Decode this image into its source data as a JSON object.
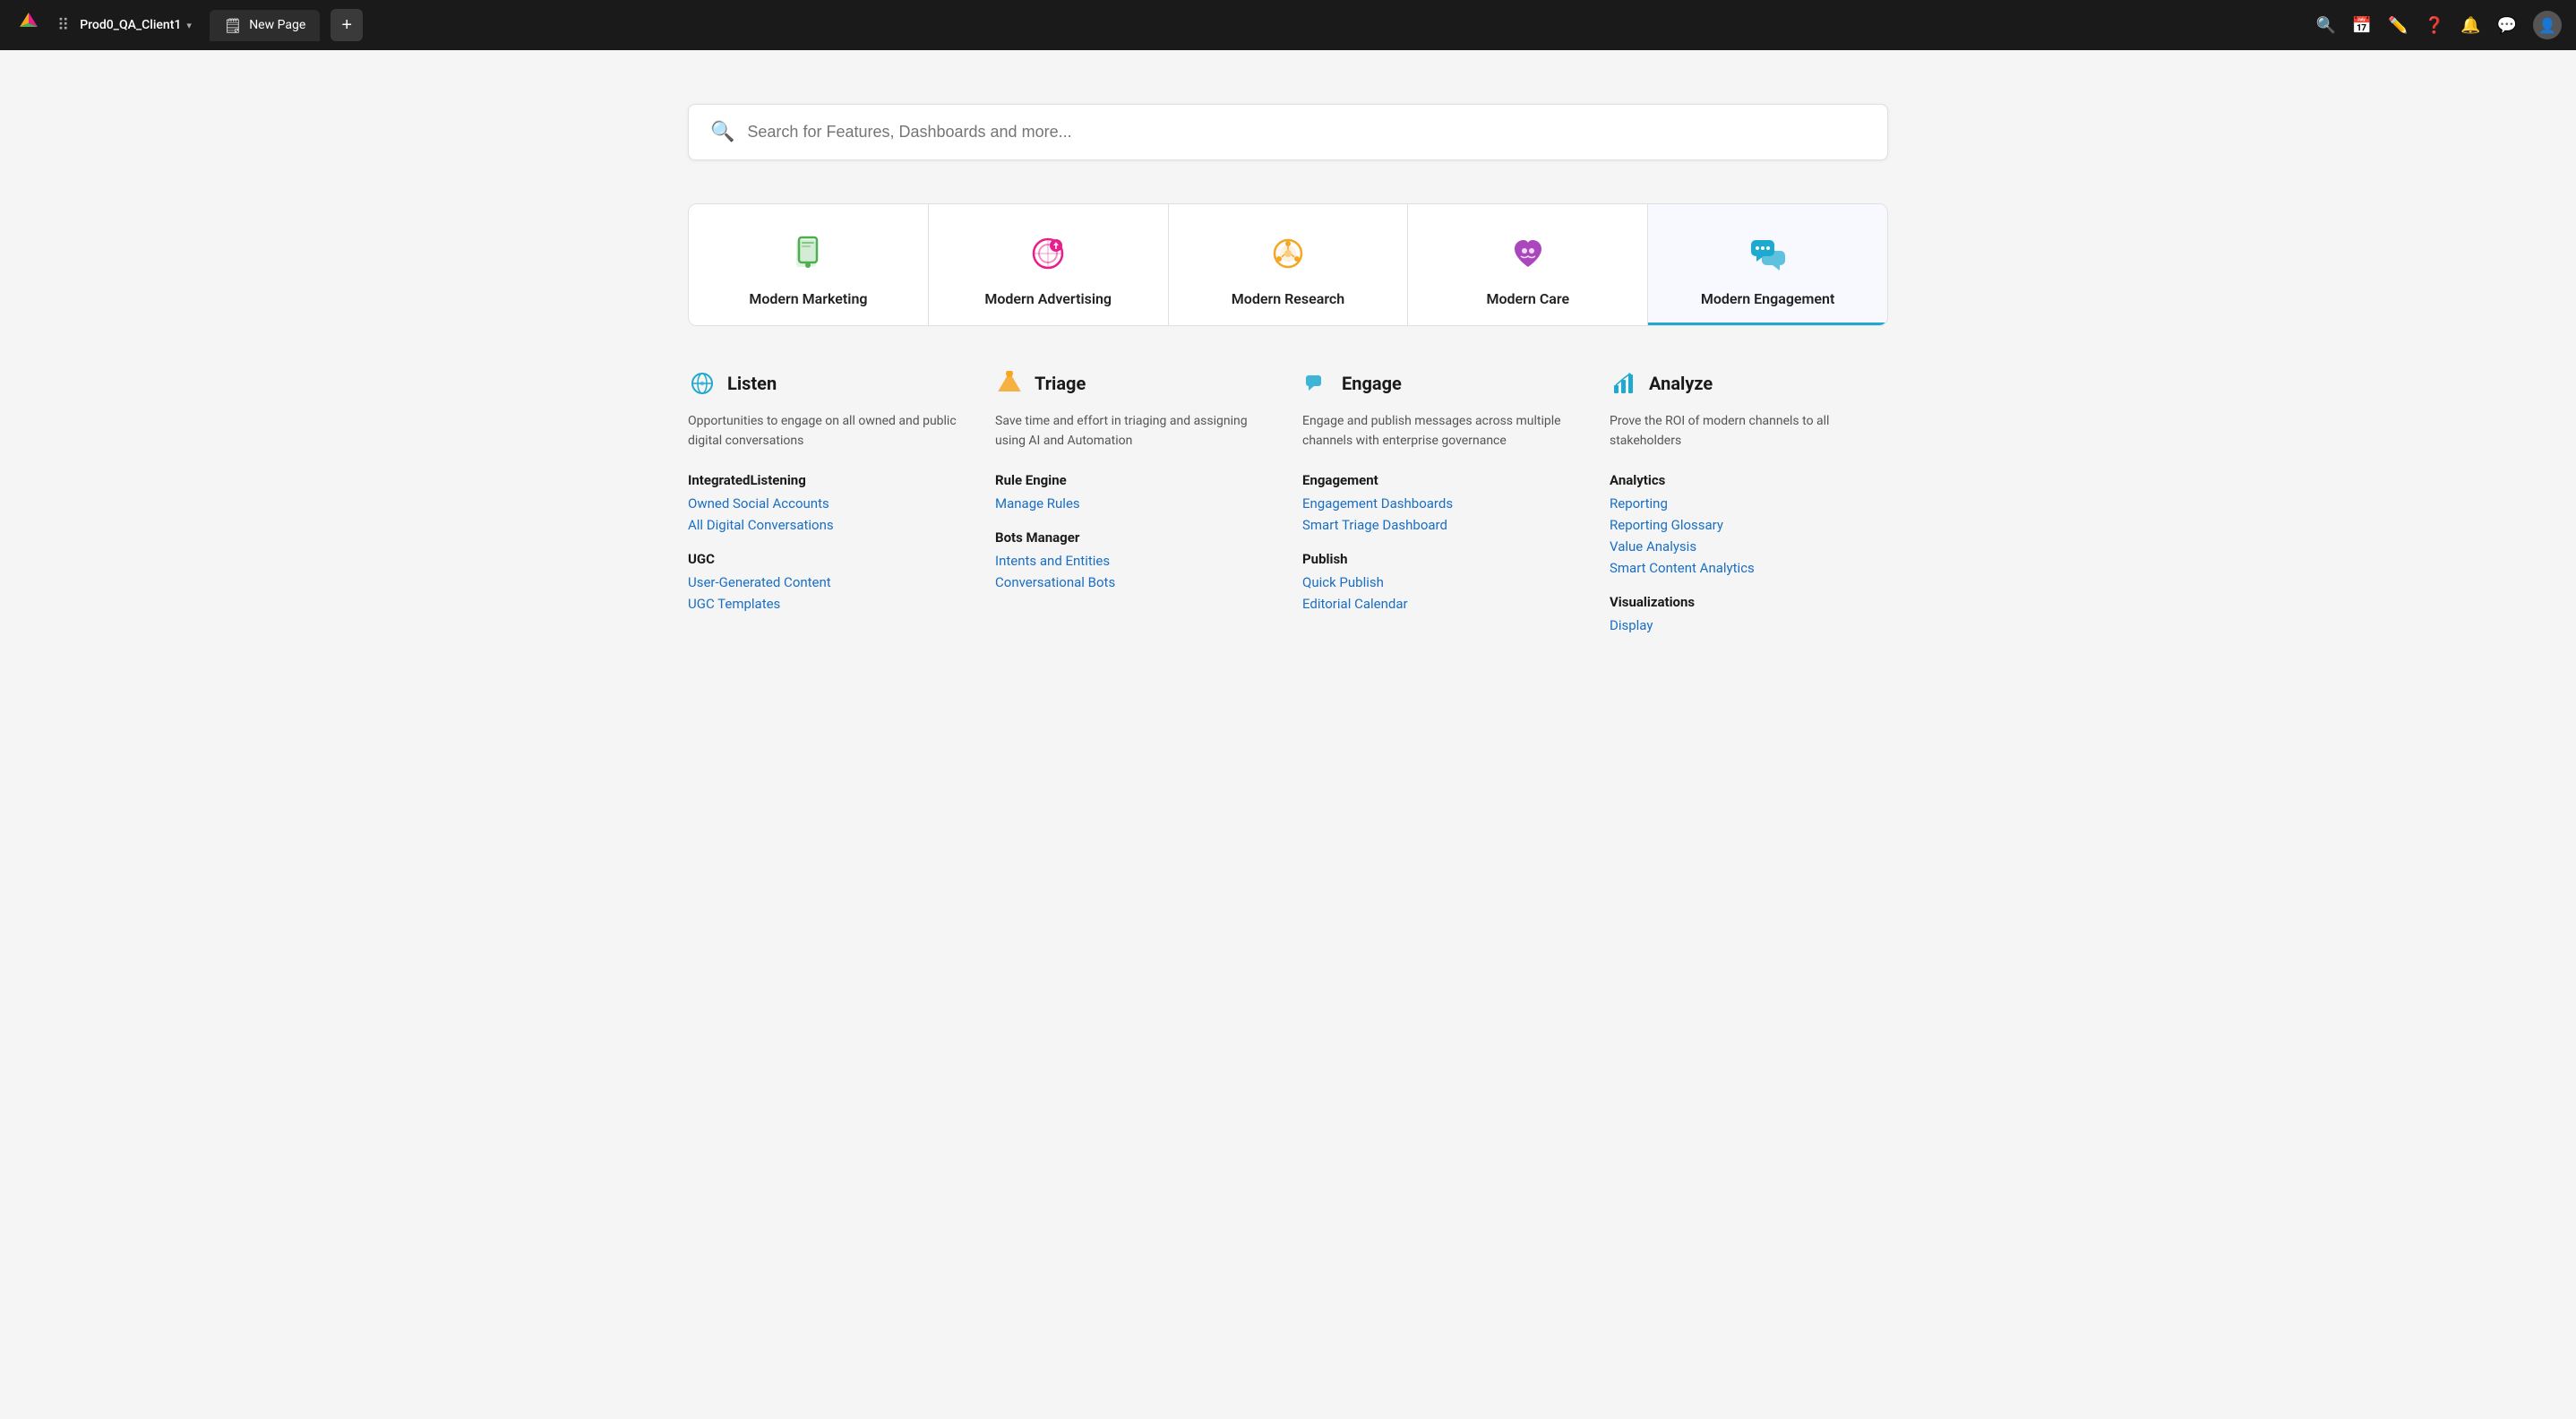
{
  "topnav": {
    "client_name": "Prod0_QA_Client1",
    "tab_label": "New Page",
    "add_button_label": "+",
    "icons": [
      "search",
      "calendar",
      "edit",
      "help",
      "bell",
      "chat",
      "user"
    ]
  },
  "search": {
    "placeholder": "Search for Features, Dashboards and more..."
  },
  "module_tabs": [
    {
      "id": "marketing",
      "label": "Modern Marketing",
      "active": false
    },
    {
      "id": "advertising",
      "label": "Modern Advertising",
      "active": false
    },
    {
      "id": "research",
      "label": "Modern Research",
      "active": false
    },
    {
      "id": "care",
      "label": "Modern Care",
      "active": false
    },
    {
      "id": "engagement",
      "label": "Modern Engagement",
      "active": true
    }
  ],
  "sections": [
    {
      "id": "listen",
      "title": "Listen",
      "description": "Opportunities to engage on all owned and public digital conversations",
      "subsections": [
        {
          "label": "IntegratedListening",
          "links": [
            "Owned Social Accounts",
            "All Digital Conversations"
          ]
        },
        {
          "label": "UGC",
          "links": [
            "User-Generated Content",
            "UGC Templates"
          ]
        }
      ]
    },
    {
      "id": "triage",
      "title": "Triage",
      "description": "Save time and effort in triaging and assigning using AI and Automation",
      "subsections": [
        {
          "label": "Rule Engine",
          "links": [
            "Manage Rules"
          ]
        },
        {
          "label": "Bots Manager",
          "links": [
            "Intents and Entities",
            "Conversational Bots"
          ]
        }
      ]
    },
    {
      "id": "engage",
      "title": "Engage",
      "description": "Engage and publish messages across multiple channels with enterprise governance",
      "subsections": [
        {
          "label": "Engagement",
          "links": [
            "Engagement Dashboards",
            "Smart Triage Dashboard"
          ]
        },
        {
          "label": "Publish",
          "links": [
            "Quick Publish",
            "Editorial Calendar"
          ]
        }
      ]
    },
    {
      "id": "analyze",
      "title": "Analyze",
      "description": "Prove the ROI of modern channels to all stakeholders",
      "subsections": [
        {
          "label": "Analytics",
          "links": [
            "Reporting",
            "Reporting Glossary",
            "Value Analysis",
            "Smart Content Analytics"
          ]
        },
        {
          "label": "Visualizations",
          "links": [
            "Display"
          ]
        }
      ]
    }
  ]
}
